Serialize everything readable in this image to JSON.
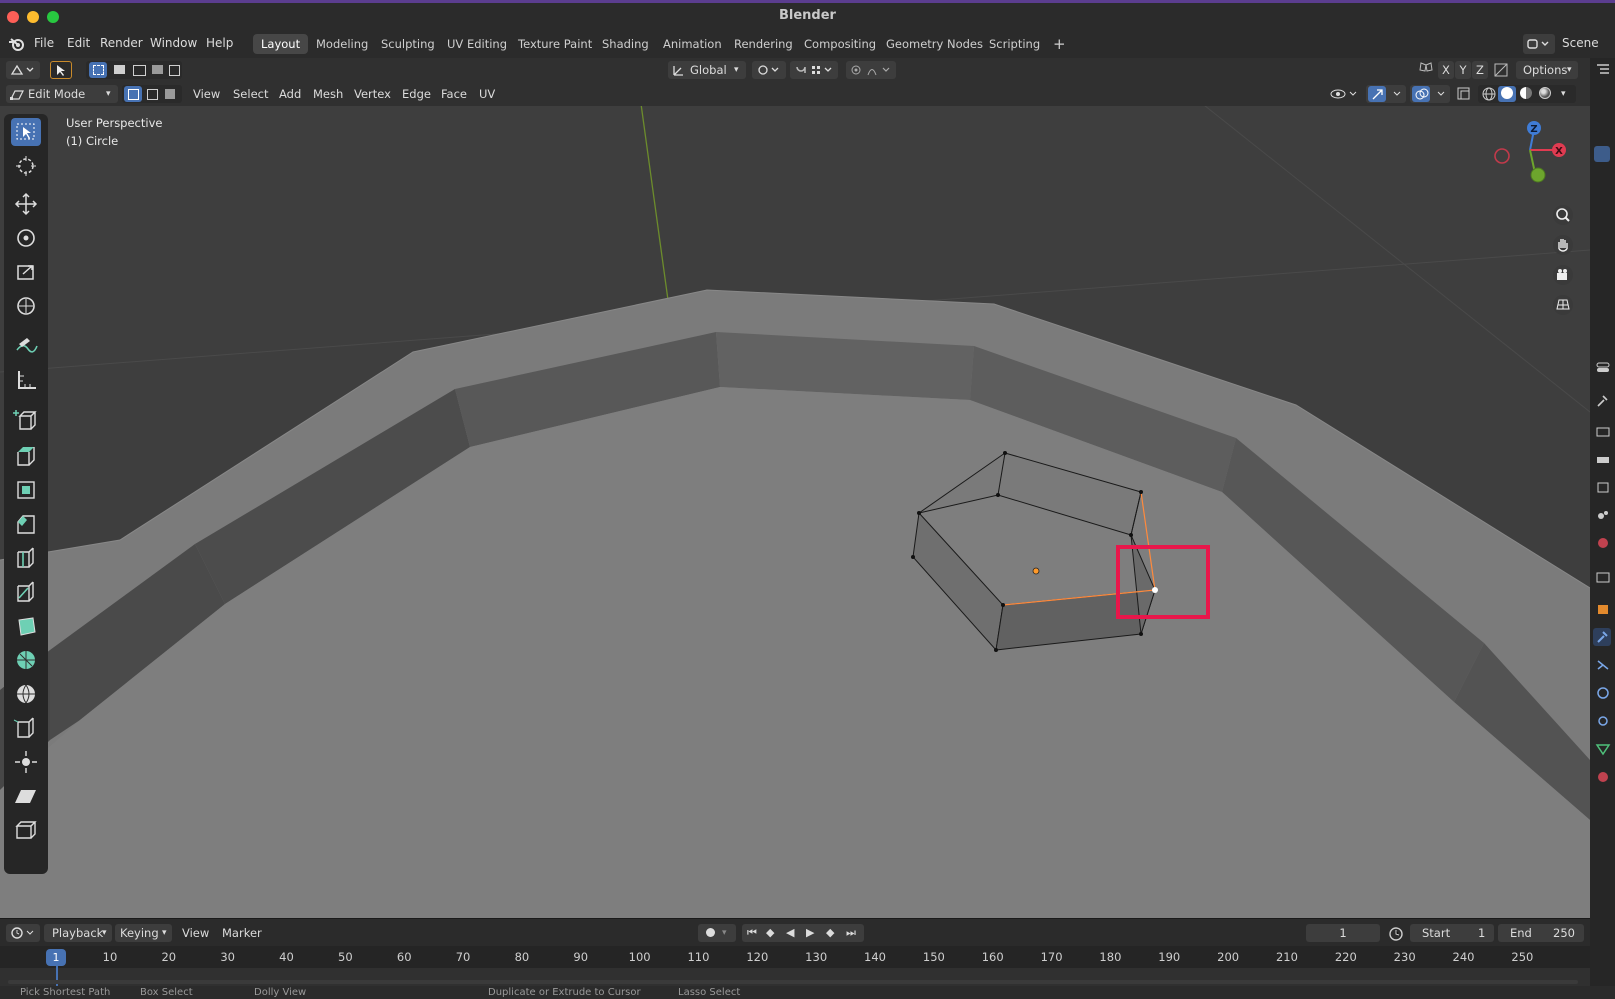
{
  "app": {
    "title": "Blender"
  },
  "menu": [
    "File",
    "Edit",
    "Render",
    "Window",
    "Help"
  ],
  "workspaces": [
    "Layout",
    "Modeling",
    "Sculpting",
    "UV Editing",
    "Texture Paint",
    "Shading",
    "Animation",
    "Rendering",
    "Compositing",
    "Geometry Nodes",
    "Scripting"
  ],
  "active_workspace": "Layout",
  "scene": {
    "label": "Scene"
  },
  "header": {
    "orientation": "Global",
    "axes": [
      "X",
      "Y",
      "Z"
    ],
    "options": "Options",
    "mode": "Edit Mode",
    "menus": [
      "View",
      "Select",
      "Add",
      "Mesh",
      "Vertex",
      "Edge",
      "Face",
      "UV"
    ]
  },
  "viewport": {
    "perspective": "User Perspective",
    "object": "(1) Circle",
    "gizmo": {
      "z": "Z",
      "x": "X"
    }
  },
  "timeline": {
    "menus": [
      "Playback",
      "Keying",
      "View",
      "Marker"
    ],
    "current_frame": "1",
    "start_label": "Start",
    "start_value": "1",
    "end_label": "End",
    "end_value": "250",
    "ticks": [
      "10",
      "20",
      "30",
      "40",
      "50",
      "60",
      "70",
      "80",
      "90",
      "100",
      "110",
      "120",
      "130",
      "140",
      "150",
      "160",
      "170",
      "180",
      "190",
      "200",
      "210",
      "220",
      "230",
      "240",
      "250"
    ],
    "playhead": "1"
  },
  "status": {
    "items": [
      "Pick Shortest Path",
      "Box Select",
      "Dolly View",
      "Duplicate or Extrude to Cursor",
      "Lasso Select"
    ]
  },
  "colors": {
    "accent": "#4772b3",
    "highlight_box": "#e8174b",
    "selection": "#ff8a3d"
  }
}
